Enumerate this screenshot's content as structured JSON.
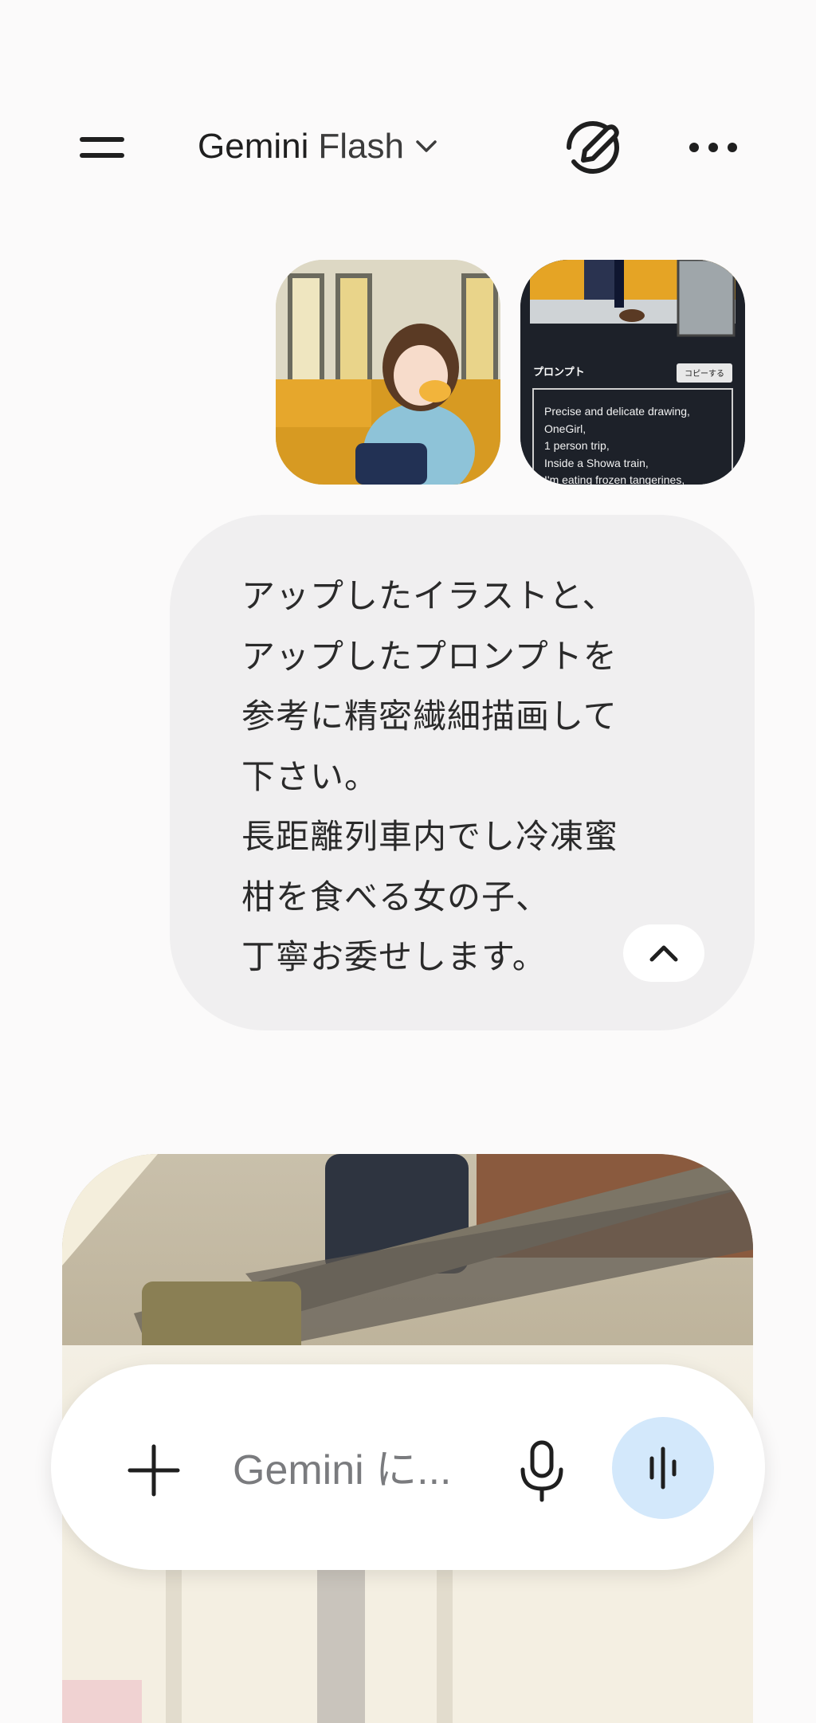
{
  "header": {
    "model_brand": "Gemini",
    "model_variant": "Flash",
    "icons": {
      "menu": "menu-icon",
      "dropdown": "chevron-down-icon",
      "new_chat": "edit-pen-icon",
      "more": "more-horizontal-icon"
    }
  },
  "attachments": {
    "prompt_image": {
      "heading": "プロンプト",
      "copy_label": "コピーする",
      "lines": [
        "Precise and delicate drawing,",
        "OneGirl,",
        "1 person trip,",
        "Inside a Showa train,",
        "I'm eating frozen tangerines,"
      ]
    }
  },
  "message": {
    "text": "アップしたイラストと、\nアップしたプロンプトを\n参考に精密繊細描画して\n下さい。\n長距離列車内でし冷凍蜜\n柑を食べる女の子、\n丁寧お委せします。",
    "collapse_icon": "chevron-up-icon"
  },
  "composer": {
    "placeholder": "Gemini に...",
    "icons": {
      "add": "plus-icon",
      "mic": "microphone-icon",
      "live": "live-audio-icon"
    }
  },
  "colors": {
    "background": "#fbfafa",
    "bubble": "#f0eff0",
    "live_button": "#d3e8fb",
    "text": "#1f1f1f"
  }
}
